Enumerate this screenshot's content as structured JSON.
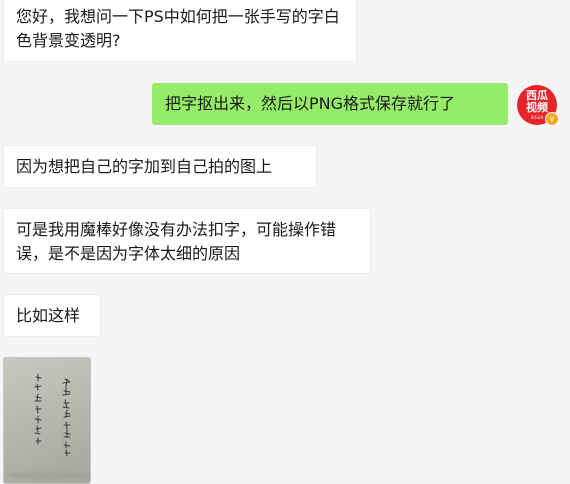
{
  "messages": [
    {
      "side": "left",
      "text": "您好，我想问一下PS中如何把一张手写的字白色背景变透明?"
    },
    {
      "side": "right",
      "text": "把字抠出来，然后以PNG格式保存就行了"
    },
    {
      "side": "left",
      "text": "因为想把自己的字加到自己拍的图上"
    },
    {
      "side": "left",
      "text": "可是我用魔棒好像没有办法扣字，可能操作错误，是不是因为字体太细的原因"
    },
    {
      "side": "left",
      "text": "比如这样"
    }
  ],
  "avatar": {
    "line1": "西瓜",
    "line2": "视频",
    "small": "XIGUA",
    "badge": "v"
  },
  "colors": {
    "outgoing": "#95ec69",
    "incoming": "#ffffff",
    "background": "#f5f5f5",
    "avatar": "#e8242b"
  },
  "image_message": {
    "description_icon": "handwriting-photo"
  }
}
